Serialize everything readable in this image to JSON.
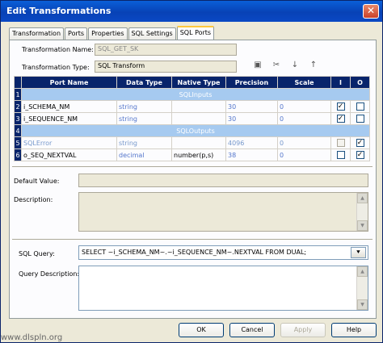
{
  "window": {
    "title": "Edit Transformations",
    "close_glyph": "✕"
  },
  "tabs": [
    {
      "label": "Transformation"
    },
    {
      "label": "Ports"
    },
    {
      "label": "Properties"
    },
    {
      "label": "SQL Settings"
    },
    {
      "label": "SQL Ports",
      "active": true
    }
  ],
  "form": {
    "name_label": "Transformation Name:",
    "name_value": "SQL_GET_SK",
    "type_label": "Transformation Type:",
    "type_value": "SQL Transform"
  },
  "toolbar": [
    {
      "icon": "new-port-icon",
      "glyph": "▣"
    },
    {
      "icon": "cut-icon",
      "glyph": "✂"
    },
    {
      "icon": "move-down-icon",
      "glyph": "↓"
    },
    {
      "icon": "move-up-icon",
      "glyph": "↑"
    }
  ],
  "grid": {
    "headers": [
      "Port Name",
      "Data Type",
      "Native Type",
      "Precision",
      "Scale",
      "I",
      "O"
    ],
    "rows": [
      {
        "n": "1",
        "group": "SQLInputs"
      },
      {
        "n": "2",
        "name": "i_SCHEMA_NM",
        "dtype": "string",
        "native": "",
        "precision": "30",
        "scale": "0",
        "i": true,
        "o": false
      },
      {
        "n": "3",
        "name": "i_SEQUENCE_NM",
        "dtype": "string",
        "native": "",
        "precision": "30",
        "scale": "0",
        "i": true,
        "o": false
      },
      {
        "n": "4",
        "group": "SQLOutputs"
      },
      {
        "n": "5",
        "name": "SQLError",
        "dtype": "string",
        "native": "",
        "precision": "4096",
        "scale": "0",
        "i": false,
        "o": true,
        "disabled": true
      },
      {
        "n": "6",
        "name": "o_SEQ_NEXTVAL",
        "dtype": "decimal",
        "native": "number(p,s)",
        "precision": "38",
        "scale": "0",
        "i": false,
        "o": true
      }
    ]
  },
  "default_value_label": "Default Value:",
  "description_label": "Description:",
  "sql": {
    "query_label": "SQL Query:",
    "query_value": "SELECT ~i_SCHEMA_NM~.~i_SEQUENCE_NM~.NEXTVAL FROM DUAL;",
    "dropdown_glyph": "⯆",
    "desc_label": "Query Description:"
  },
  "buttons": {
    "ok": "OK",
    "cancel": "Cancel",
    "apply": "Apply",
    "help": "Help"
  },
  "watermark": "www.dlspln.org",
  "colors": {
    "header_bg": "#08246b",
    "group_bg": "#a6caf0",
    "dialog_bg": "#ece9d8"
  }
}
